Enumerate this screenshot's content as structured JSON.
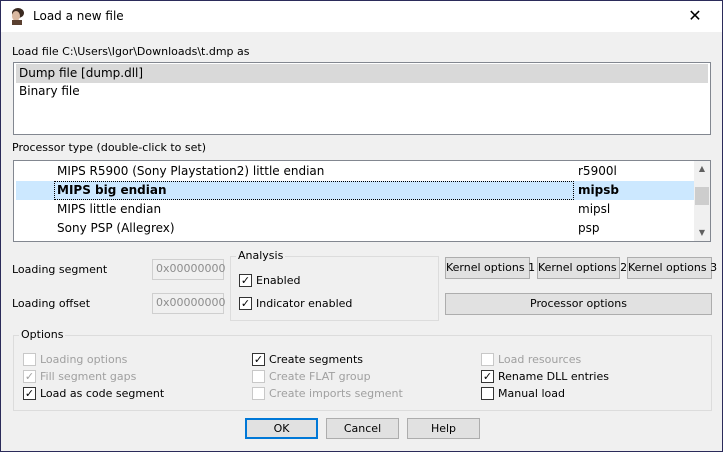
{
  "window": {
    "title": "Load a new file",
    "icon": "app-portrait-icon",
    "close_icon": "close-icon"
  },
  "file_label": "Load file C:\\Users\\Igor\\Downloads\\t.dmp as",
  "file_types": [
    {
      "label": "Dump file [dump.dll]",
      "selected": true
    },
    {
      "label": "Binary file",
      "selected": false
    }
  ],
  "processor_label": "Processor type (double-click to set)",
  "processors": [
    {
      "name": "MIPS R5900 (Sony Playstation2) little endian",
      "code": "r5900l",
      "selected": false
    },
    {
      "name": "MIPS big endian",
      "code": "mipsb",
      "selected": true
    },
    {
      "name": "MIPS little endian",
      "code": "mipsl",
      "selected": false
    },
    {
      "name": "Sony PSP (Allegrex)",
      "code": "psp",
      "selected": false
    }
  ],
  "loading_segment": {
    "label": "Loading segment",
    "value": "0x00000000"
  },
  "loading_offset": {
    "label": "Loading offset",
    "value": "0x00000000"
  },
  "analysis": {
    "title": "Analysis",
    "enabled": {
      "label": "Enabled",
      "checked": true
    },
    "indicator": {
      "label": "Indicator enabled",
      "checked": true
    }
  },
  "buttons": {
    "kernel1": "Kernel options 1",
    "kernel2": "Kernel options 2",
    "kernel3": "Kernel options 3",
    "processor": "Processor options",
    "ok": "OK",
    "cancel": "Cancel",
    "help": "Help"
  },
  "options": {
    "title": "Options",
    "items": [
      {
        "label": "Loading options",
        "checked": false,
        "disabled": true
      },
      {
        "label": "Fill segment gaps",
        "checked": true,
        "disabled": true
      },
      {
        "label": "Load as code segment",
        "checked": true,
        "disabled": false
      },
      {
        "label": "Create segments",
        "checked": true,
        "disabled": false
      },
      {
        "label": "Create FLAT group",
        "checked": false,
        "disabled": true
      },
      {
        "label": "Create imports segment",
        "checked": false,
        "disabled": true
      },
      {
        "label": "Load resources",
        "checked": false,
        "disabled": true
      },
      {
        "label": "Rename DLL entries",
        "checked": true,
        "disabled": false
      },
      {
        "label": "Manual load",
        "checked": false,
        "disabled": false
      }
    ]
  },
  "colors": {
    "selection": "#cce8ff",
    "list_selected_gray": "#d9d9d9",
    "default_button_border": "#0078d7"
  }
}
